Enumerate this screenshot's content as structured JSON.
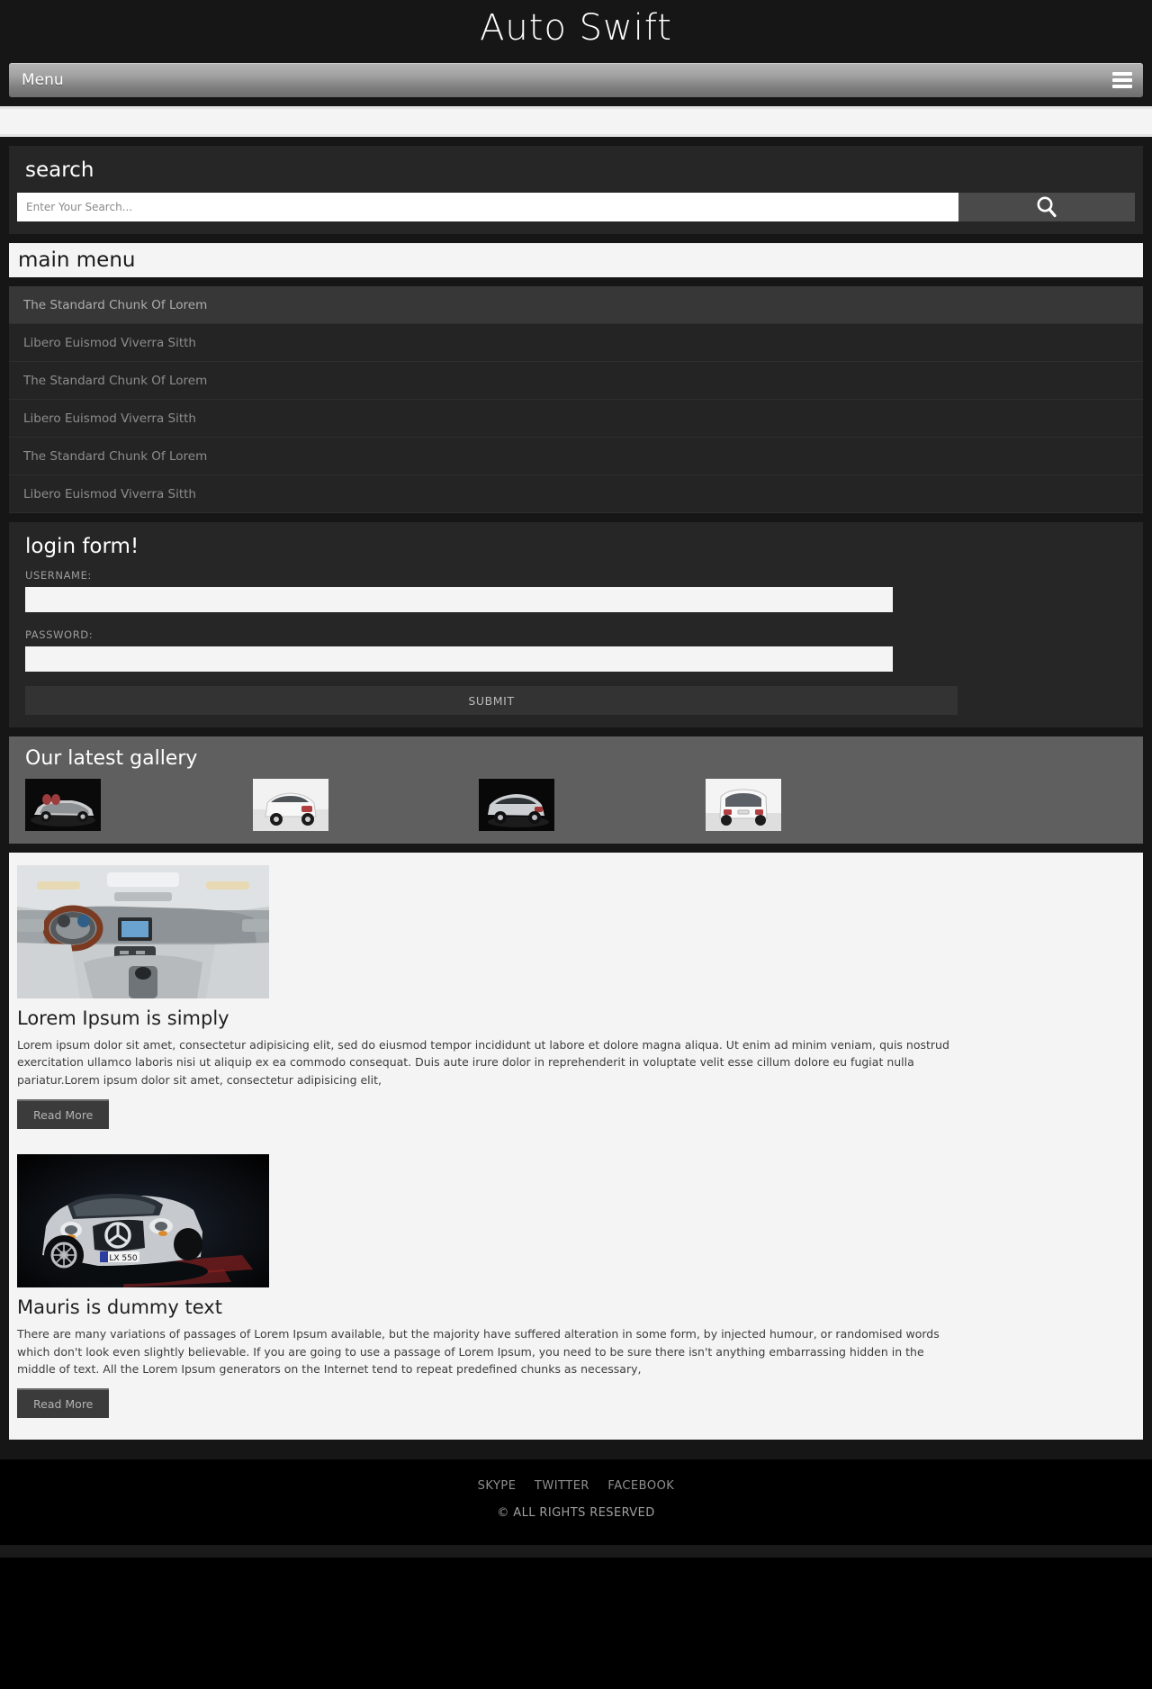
{
  "site": {
    "logo": "Auto Swift"
  },
  "menubar": {
    "label": "Menu",
    "toggle_icon": "hamburger-icon"
  },
  "search": {
    "title": "search",
    "placeholder": "Enter Your Search...",
    "value": "",
    "button_icon": "search-icon"
  },
  "main_menu": {
    "title": "main menu",
    "items": [
      {
        "label": "The Standard Chunk Of Lorem",
        "active": true
      },
      {
        "label": "Libero Euismod Viverra Sitth",
        "active": false
      },
      {
        "label": "The Standard Chunk Of Lorem",
        "active": false
      },
      {
        "label": "Libero Euismod Viverra Sitth",
        "active": false
      },
      {
        "label": "The Standard Chunk Of Lorem",
        "active": false
      },
      {
        "label": "Libero Euismod Viverra Sitth",
        "active": false
      }
    ]
  },
  "login": {
    "title": "login form!",
    "username_label": "USERNAME:",
    "username_value": "",
    "password_label": "PASSWORD:",
    "password_value": "",
    "submit_label": "SUBMIT"
  },
  "gallery": {
    "title": "Our latest gallery",
    "items": [
      {
        "alt": "silver-roadster-dark-background"
      },
      {
        "alt": "white-convertible-rear-three-quarter"
      },
      {
        "alt": "silver-hatchback-dark-background"
      },
      {
        "alt": "white-hatchback-rear-view"
      }
    ]
  },
  "articles": [
    {
      "image_alt": "car-interior-dashboard-steering-wheel",
      "title": "Lorem Ipsum is simply",
      "body": "Lorem ipsum dolor sit amet, consectetur adipisicing elit, sed do eiusmod tempor incididunt ut labore et dolore magna aliqua. Ut enim ad minim veniam, quis nostrud exercitation ullamco laboris nisi ut aliquip ex ea commodo consequat. Duis aute irure dolor in reprehenderit in voluptate velit esse cillum dolore eu fugiat nulla pariatur.Lorem ipsum dolor sit amet, consectetur adipisicing elit,",
      "read_more": "Read More"
    },
    {
      "image_alt": "silver-mercedes-convertible-front-view",
      "title": "Mauris is dummy text",
      "body": "There are many variations of passages of Lorem Ipsum available, but the majority have suffered alteration in some form, by injected humour, or randomised words which don't look even slightly believable. If you are going to use a passage of Lorem Ipsum, you need to be sure there isn't anything embarrassing hidden in the middle of text. All the Lorem Ipsum generators on the Internet tend to repeat predefined chunks as necessary,",
      "read_more": "Read More"
    }
  ],
  "footer": {
    "social": [
      "SKYPE",
      "TWITTER",
      "FACEBOOK"
    ],
    "copyright": "© ALL RIGHTS RESERVED"
  },
  "colors": {
    "page_dark": "#161616",
    "panel_dark": "#262626",
    "menu_item": "#242424",
    "menu_item_active": "#373737",
    "gallery_bg": "#5f5f5f",
    "content_bg": "#f4f4f4",
    "footer_bg": "#000000",
    "text_muted": "#8d8d8d"
  }
}
